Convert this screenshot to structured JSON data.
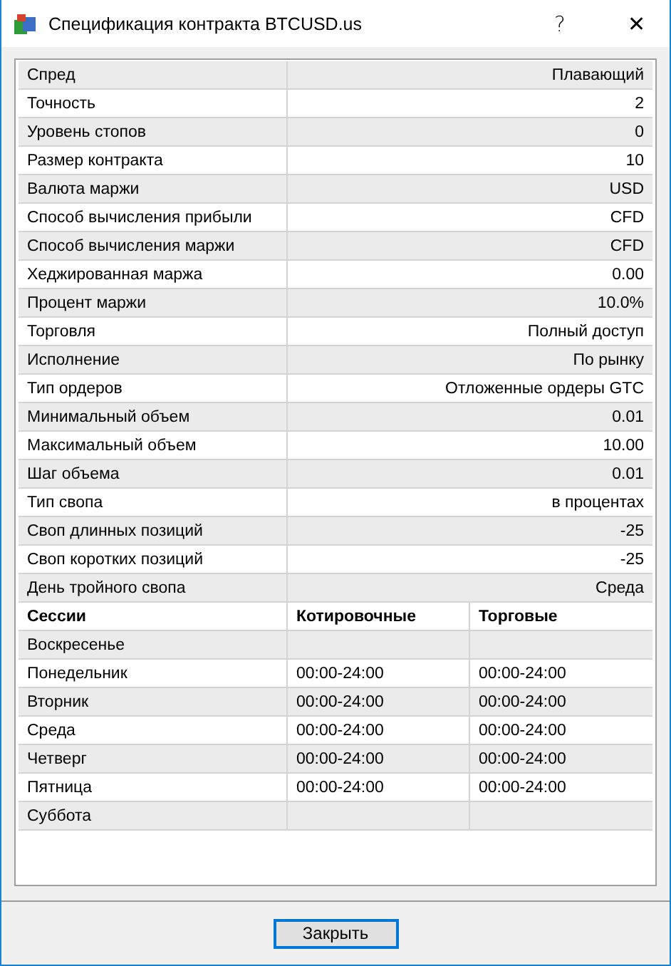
{
  "window": {
    "title": "Спецификация контракта BTCUSD.us",
    "help": "?",
    "close": "✕"
  },
  "properties": [
    {
      "name": "Спред",
      "value": "Плавающий"
    },
    {
      "name": "Точность",
      "value": "2"
    },
    {
      "name": "Уровень стопов",
      "value": "0"
    },
    {
      "name": "Размер контракта",
      "value": "10"
    },
    {
      "name": "Валюта маржи",
      "value": "USD"
    },
    {
      "name": "Способ вычисления прибыли",
      "value": "CFD"
    },
    {
      "name": "Способ вычисления маржи",
      "value": "CFD"
    },
    {
      "name": "Хеджированная маржа",
      "value": "0.00"
    },
    {
      "name": "Процент маржи",
      "value": "10.0%"
    },
    {
      "name": "Торговля",
      "value": "Полный доступ"
    },
    {
      "name": "Исполнение",
      "value": "По рынку"
    },
    {
      "name": "Тип ордеров",
      "value": "Отложенные ордеры GTC"
    },
    {
      "name": "Минимальный объем",
      "value": "0.01"
    },
    {
      "name": "Максимальный объем",
      "value": "10.00"
    },
    {
      "name": "Шаг объема",
      "value": "0.01"
    },
    {
      "name": "Тип свопа",
      "value": "в процентах"
    },
    {
      "name": "Своп длинных позиций",
      "value": "-25"
    },
    {
      "name": "Своп коротких позиций",
      "value": "-25"
    },
    {
      "name": "День тройного свопа",
      "value": "Среда"
    }
  ],
  "sessions": {
    "columns": [
      "Сессии",
      "Котировочные",
      "Торговые"
    ],
    "rows": [
      {
        "day": "Воскресенье"
      },
      {
        "day": "Понедельник",
        "quotes": "00:00-24:00",
        "trades": "00:00-24:00"
      },
      {
        "day": "Вторник",
        "quotes": "00:00-24:00",
        "trades": "00:00-24:00"
      },
      {
        "day": "Среда",
        "quotes": "00:00-24:00",
        "trades": "00:00-24:00"
      },
      {
        "day": "Четверг",
        "quotes": "00:00-24:00",
        "trades": "00:00-24:00"
      },
      {
        "day": "Пятница",
        "quotes": "00:00-24:00",
        "trades": "00:00-24:00"
      },
      {
        "day": "Суббота"
      }
    ]
  },
  "buttons": [
    "Закрыть"
  ]
}
